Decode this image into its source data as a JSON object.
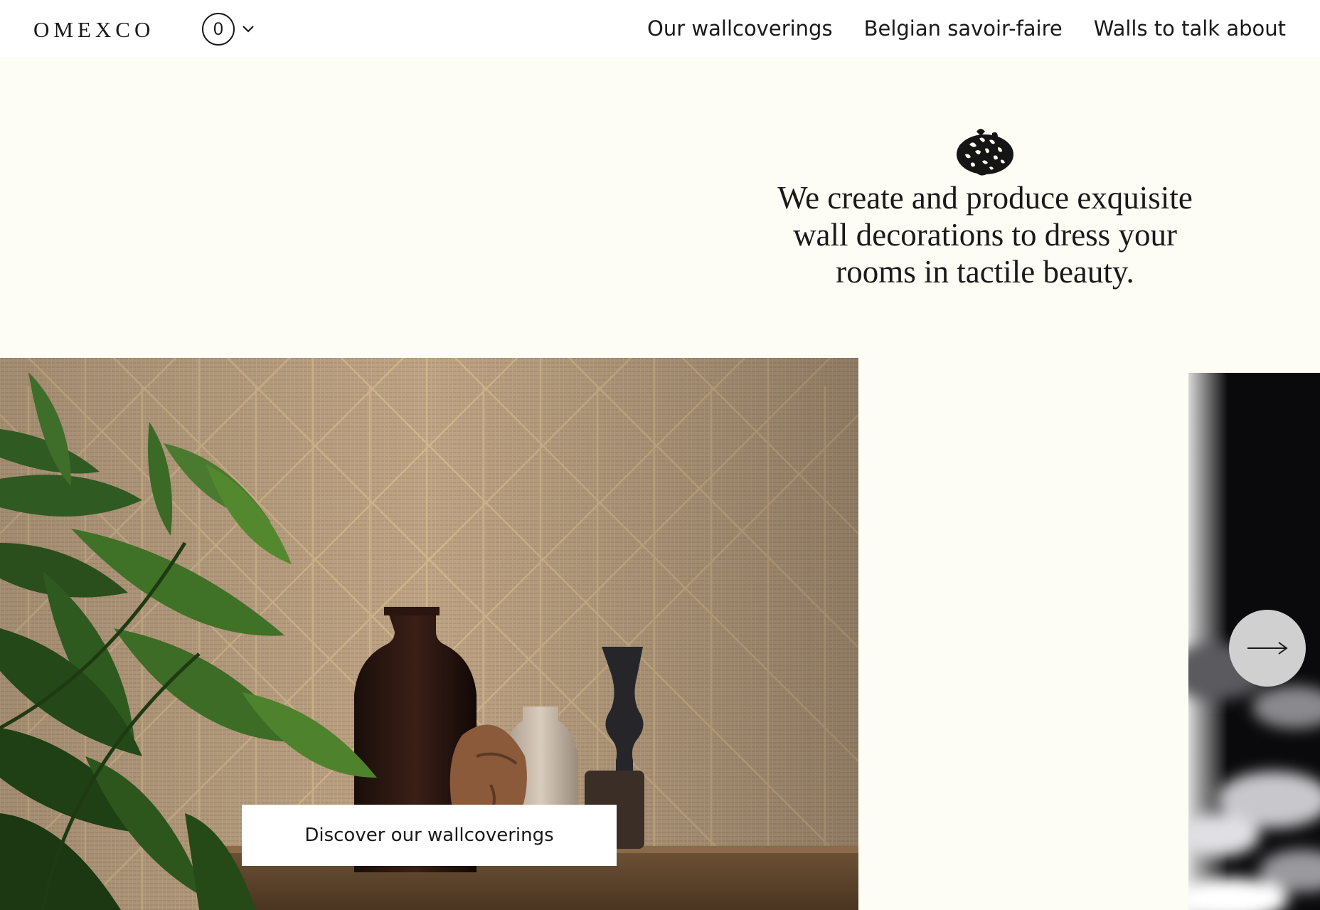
{
  "header": {
    "logo": "OMEXCO",
    "cart_count": "0",
    "nav": [
      {
        "label": "Our wallcoverings"
      },
      {
        "label": "Belgian savoir-faire"
      },
      {
        "label": "Walls to talk about"
      }
    ]
  },
  "hero": {
    "tagline_lines": [
      "We create and produce exquisite",
      "wall decorations to dress your",
      "rooms in tactile beauty."
    ]
  },
  "slides": {
    "cta_label": "Discover our wallcoverings"
  },
  "icons": {
    "cart": "cart-count-circle",
    "chevron": "chevron-down-icon",
    "emblem": "floral-emblem-icon",
    "next": "arrow-right-icon"
  },
  "colors": {
    "background": "#fdfdf5",
    "header": "#ffffff",
    "text": "#1a1a1a",
    "next_button": "#d0d0d0"
  }
}
